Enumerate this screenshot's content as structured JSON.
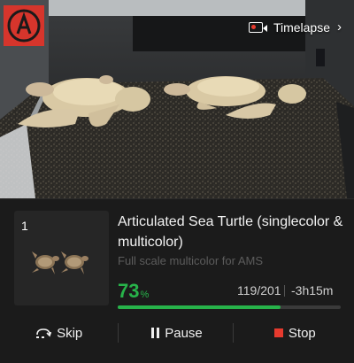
{
  "camera": {
    "timelapse_label": "Timelapse",
    "chevron": "›"
  },
  "job": {
    "plate_number": "1",
    "title": "Articulated Sea Turtle (singlecolor & multicolor)",
    "subtitle": "Full scale multicolor for AMS",
    "percent": "73",
    "percent_symbol": "%",
    "progress_fraction": 0.73,
    "layers": "119/201",
    "remaining": "-3h15m"
  },
  "actions": {
    "skip_label": "Skip",
    "pause_label": "Pause",
    "stop_label": "Stop"
  },
  "colors": {
    "accent_green": "#27b34a",
    "stop_red": "#e63a2e"
  }
}
